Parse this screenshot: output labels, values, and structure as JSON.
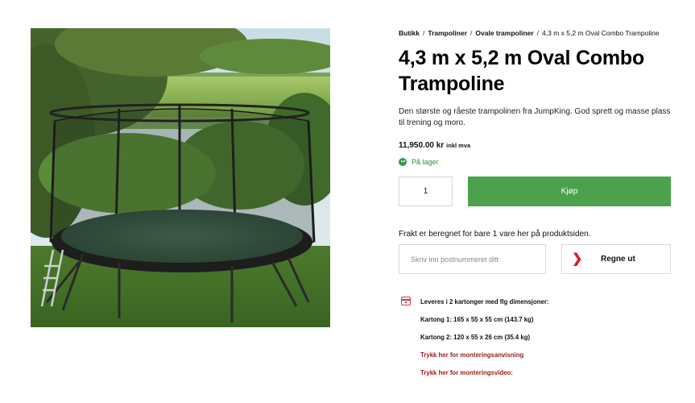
{
  "breadcrumb": [
    {
      "label": "Butikk"
    },
    {
      "label": "Trampoliner"
    },
    {
      "label": "Ovale trampoliner"
    },
    {
      "label": "4,3 m x 5,2 m Oval Combo Trampoline"
    }
  ],
  "product": {
    "title": "4,3 m x 5,2 m Oval Combo Trampoline",
    "description": "Den største og råeste trampolinen fra JumpKing. God sprett og masse plass til trening og moro.",
    "price": "11,950.00 kr",
    "vat_note": "inkl mva",
    "stock": "På lager",
    "quantity": "1",
    "buy_label": "Kjøp",
    "image_subject": "trampoline-photo"
  },
  "shipping": {
    "note": "Frakt er beregnet for bare 1 vare her på produktsiden.",
    "postcode_placeholder": "Skriv inn postnummeret ditt",
    "calc_label": "Regne ut"
  },
  "delivery": {
    "heading": "Leveres i 2 kartonger med flg dimensjoner:",
    "box1": "Kartong 1:  165 x 55 x 55 cm (143.7 kg)",
    "box2": "Kartong 2:  120 x 55 x 26 cm (35.4 kg)",
    "link_instructions": "Trykk her for monteringsanvisning",
    "link_video": "Trykk her for monteringsvideo:"
  },
  "colors": {
    "buy_button": "#4ca24c",
    "stock_green": "#2b8a3e",
    "link_red": "#9a1c16",
    "chevron_red": "#d11f2b"
  },
  "icons": {
    "stock": "smile-circle-icon",
    "calc": "chevron-right-icon",
    "delivery": "calendar-box-icon"
  }
}
